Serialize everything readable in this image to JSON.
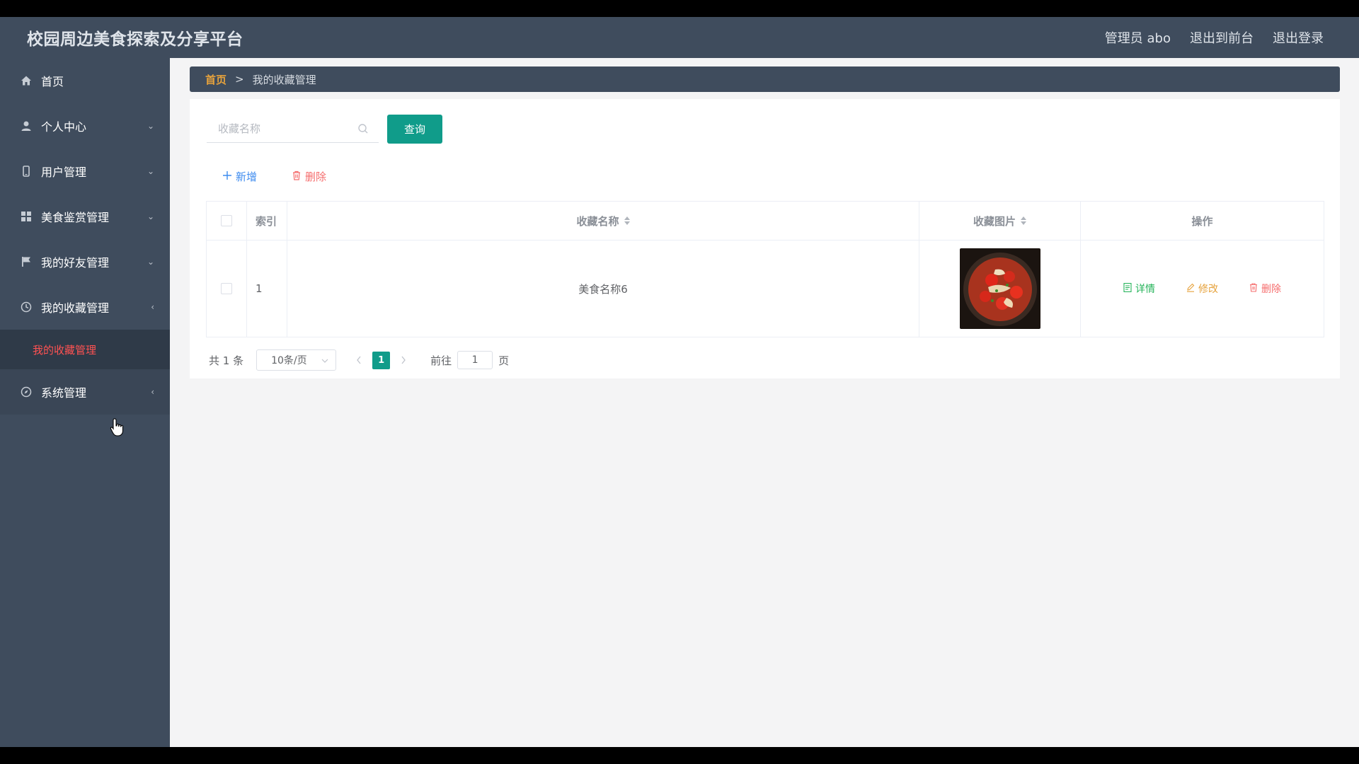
{
  "app": {
    "title": "校园周边美食探索及分享平台"
  },
  "header": {
    "admin_label": "管理员 abo",
    "to_front": "退出到前台",
    "logout": "退出登录"
  },
  "sidebar": {
    "items": [
      {
        "label": "首页",
        "icon": "home-icon",
        "arrow": ""
      },
      {
        "label": "个人中心",
        "icon": "user-icon",
        "arrow": "⌄"
      },
      {
        "label": "用户管理",
        "icon": "mobile-icon",
        "arrow": "⌄"
      },
      {
        "label": "美食鉴赏管理",
        "icon": "grid-icon",
        "arrow": "⌄"
      },
      {
        "label": "我的好友管理",
        "icon": "flag-icon",
        "arrow": "⌄"
      },
      {
        "label": "我的收藏管理",
        "icon": "clock-icon",
        "arrow": "‹"
      },
      {
        "label": "系统管理",
        "icon": "compass-icon",
        "arrow": "‹"
      }
    ],
    "sub_active": "我的收藏管理"
  },
  "breadcrumb": {
    "home": "首页",
    "sep": ">",
    "current": "我的收藏管理"
  },
  "search": {
    "placeholder": "收藏名称",
    "value": "",
    "button": "查询"
  },
  "actions": {
    "add": "新增",
    "delete": "删除"
  },
  "table": {
    "columns": [
      "索引",
      "收藏名称",
      "收藏图片",
      "操作"
    ],
    "rows": [
      {
        "index": "1",
        "name": "美食名称6",
        "image": "food-photo"
      }
    ],
    "ops": {
      "detail": "详情",
      "edit": "修改",
      "delete": "删除"
    }
  },
  "pagination": {
    "total": "共 1 条",
    "page_size": "10条/页",
    "current_page": "1",
    "goto_prefix": "前往",
    "goto_value": "1",
    "goto_suffix": "页"
  },
  "colors": {
    "sidebar_bg": "#3f4c5d",
    "primary": "#109c8a",
    "active_red": "#ff5252",
    "add_blue": "#3d8bef",
    "detail_green": "#25b35a",
    "edit_orange": "#e6a23c",
    "delete_red": "#f56c6c"
  }
}
